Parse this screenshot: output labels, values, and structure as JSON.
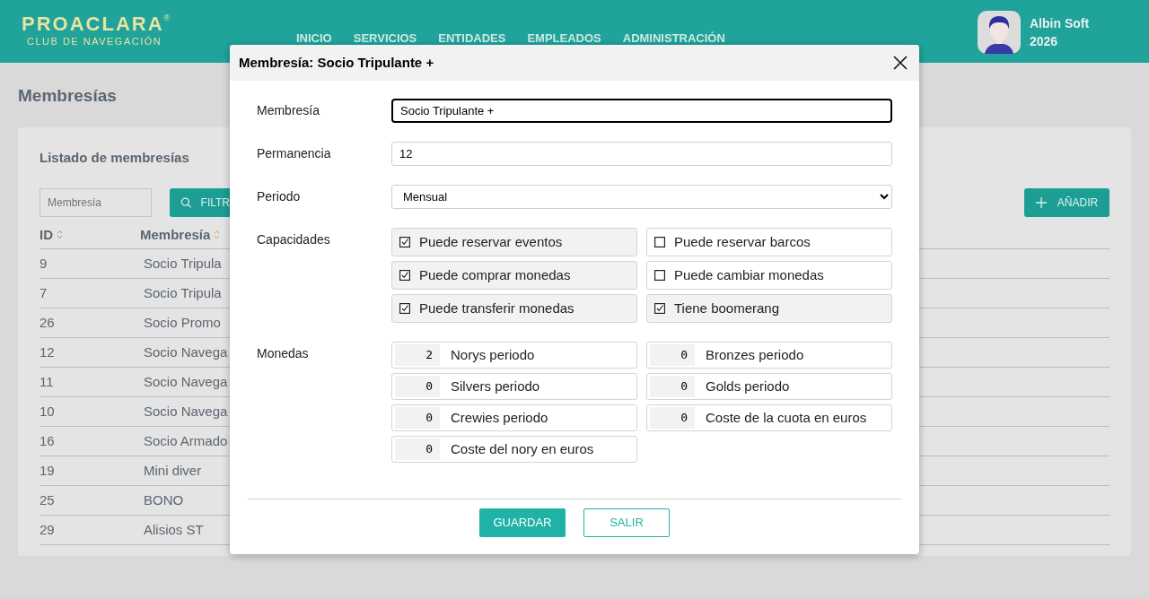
{
  "header": {
    "logo": {
      "title": "PROACLARA",
      "mark": "®",
      "subtitle": "CLUB DE NAVEGACIÓN"
    },
    "nav": [
      "INICIO",
      "SERVICIOS",
      "ENTIDADES",
      "EMPLEADOS",
      "ADMINISTRACIÓN"
    ],
    "user": {
      "name": "Albin Soft",
      "year": "2026"
    }
  },
  "page_title": "Membresías",
  "list": {
    "title": "Listado de membresías",
    "filter": {
      "placeholder": "Membresía"
    },
    "filter_button": "FILTR",
    "add_button": "AÑADIR",
    "columns": [
      {
        "label": "ID",
        "sorted": false
      },
      {
        "label": "Membresía",
        "sorted": true
      }
    ],
    "rows": [
      {
        "id": "9",
        "name": "Socio Tripula"
      },
      {
        "id": "7",
        "name": "Socio Tripula"
      },
      {
        "id": "26",
        "name": "Socio Promo"
      },
      {
        "id": "12",
        "name": "Socio Navega"
      },
      {
        "id": "11",
        "name": "Socio Navega"
      },
      {
        "id": "10",
        "name": "Socio Navega"
      },
      {
        "id": "16",
        "name": "Socio Armado"
      },
      {
        "id": "19",
        "name": "Mini diver"
      },
      {
        "id": "25",
        "name": "BONO"
      },
      {
        "id": "29",
        "name": "Alisios ST"
      }
    ]
  },
  "dialog": {
    "title": "Membresía: Socio Tripulante +",
    "fields": [
      {
        "label": "Membresía",
        "kind": "text",
        "value": "Socio Tripulante +",
        "focused": true
      },
      {
        "label": "Permanencia",
        "kind": "text",
        "value": "12",
        "focused": false
      },
      {
        "label": "Periodo",
        "kind": "select",
        "value": "Mensual",
        "focused": false
      }
    ],
    "capacities": {
      "label": "Capacidades",
      "items": [
        {
          "label": "Puede reservar eventos",
          "checked": true
        },
        {
          "label": "Puede reservar barcos",
          "checked": false
        },
        {
          "label": "Puede comprar monedas",
          "checked": true
        },
        {
          "label": "Puede cambiar monedas",
          "checked": false
        },
        {
          "label": "Puede transferir monedas",
          "checked": true
        },
        {
          "label": "Tiene boomerang",
          "checked": true
        }
      ]
    },
    "coins": {
      "label": "Monedas",
      "items": [
        {
          "value": "2",
          "label": "Norys periodo"
        },
        {
          "value": "0",
          "label": "Bronzes periodo"
        },
        {
          "value": "0",
          "label": "Silvers periodo"
        },
        {
          "value": "0",
          "label": "Golds periodo"
        },
        {
          "value": "0",
          "label": "Crewies periodo"
        },
        {
          "value": "0",
          "label": "Coste de la cuota en euros"
        },
        {
          "value": "0",
          "label": "Coste del nory en euros"
        }
      ]
    },
    "buttons": {
      "save": "GUARDAR",
      "cancel": "SALIR"
    }
  }
}
